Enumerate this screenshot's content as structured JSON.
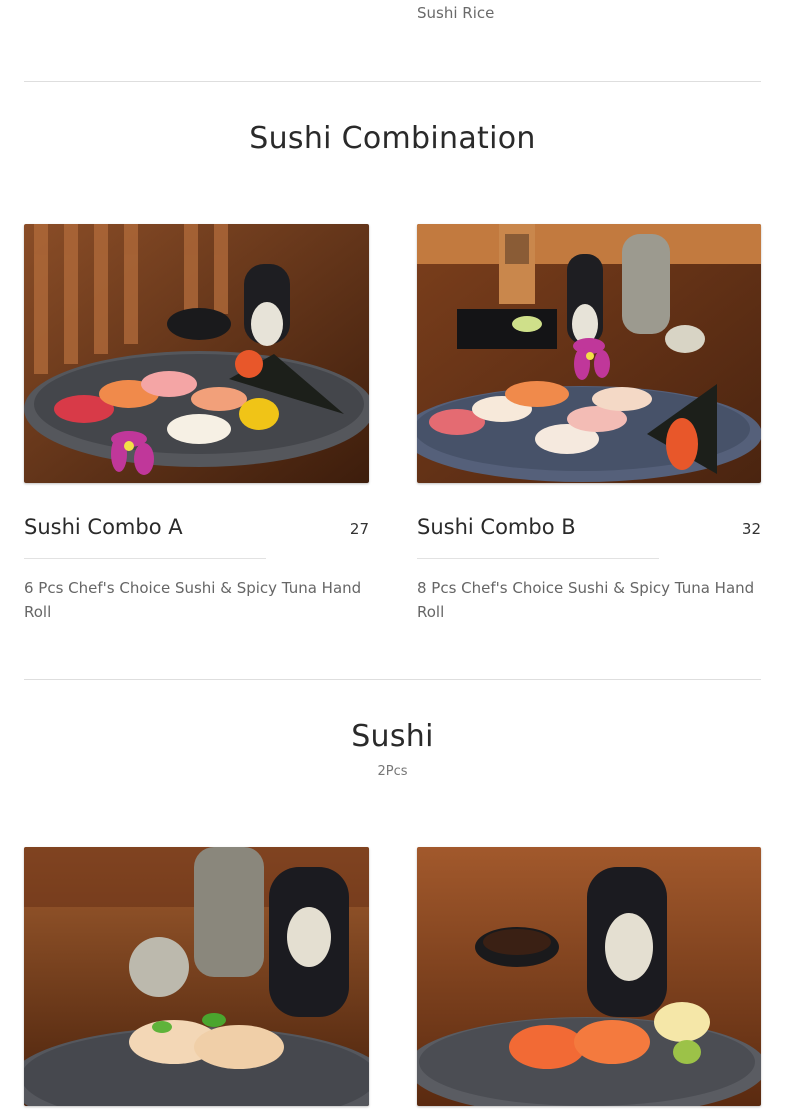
{
  "top_note": "Sushi Rice",
  "sections": [
    {
      "title": "Sushi Combination",
      "subtitle": "",
      "items": [
        {
          "name": "Sushi Combo A",
          "price": "27",
          "description": "6 Pcs Chef's Choice Sushi & Spicy Tuna Hand Roll",
          "image_icon": "sushi-combo-a-photo"
        },
        {
          "name": "Sushi Combo B",
          "price": "32",
          "description": "8 Pcs Chef's Choice Sushi & Spicy Tuna Hand Roll",
          "image_icon": "sushi-combo-b-photo"
        }
      ]
    },
    {
      "title": "Sushi",
      "subtitle": "2Pcs",
      "items": [
        {
          "image_icon": "yellowtail-sushi-photo"
        },
        {
          "image_icon": "salmon-sushi-photo"
        }
      ]
    }
  ],
  "colors": {
    "wood": "#6b3a1e",
    "plate": "#4a4c52",
    "salmon": "#f08a4b",
    "orchid": "#c0379a"
  }
}
